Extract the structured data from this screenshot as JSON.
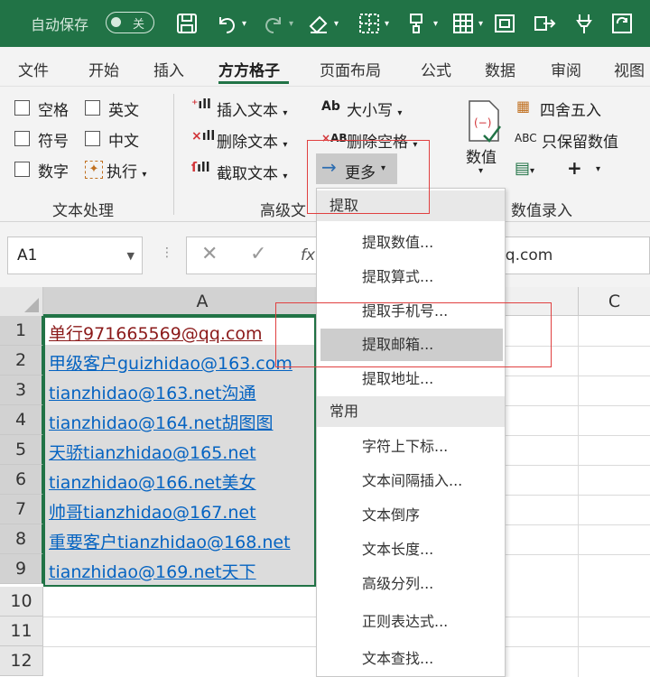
{
  "titlebar": {
    "autosave_label": "自动保存",
    "toggle_label": "关"
  },
  "menubar": {
    "tabs": [
      "文件",
      "开始",
      "插入",
      "方方格子",
      "页面布局",
      "公式",
      "数据",
      "审阅",
      "视图"
    ]
  },
  "ribbon": {
    "text_processing": {
      "checkboxes": [
        "空格",
        "英文",
        "符号",
        "中文",
        "数字"
      ],
      "execute": "执行",
      "group_label": "文本处理"
    },
    "advanced_text": {
      "insert_text": "插入文本",
      "delete_text": "删除文本",
      "extract_text": "截取文本",
      "case_label": "大小写",
      "case_icon": "Ab",
      "delete_spaces": "删除空格",
      "delete_spaces_icon": "AB",
      "more": "更多",
      "group_label": "高级文"
    },
    "numeric_entry": {
      "numeric_label": "数值",
      "round": "四舍五入",
      "keep_values": "只保留数值",
      "keep_values_icon": "ABC",
      "group_label": "数值录入"
    }
  },
  "formula_bar": {
    "name_box": "A1",
    "fx": "fx",
    "formula_visible_tail": "qq.com"
  },
  "grid": {
    "col_a": "A",
    "col_c": "C",
    "rows": [
      "1",
      "2",
      "3",
      "4",
      "5",
      "6",
      "7",
      "8",
      "9",
      "10",
      "11",
      "12"
    ],
    "cells": [
      "单行971665569@qq.com",
      "甲级客户guizhidao@163.com",
      "tianzhidao@163.net沟通",
      "tianzhidao@164.net胡图图",
      "天骄tianzhidao@165.net",
      "tianzhidao@166.net美女",
      "帅哥tianzhidao@167.net",
      "重要客户tianzhidao@168.net",
      "tianzhidao@169.net天下"
    ]
  },
  "dropdown": {
    "section_extract": "提取",
    "extract_items": [
      "提取数值...",
      "提取算式...",
      "提取手机号...",
      "提取邮箱...",
      "提取地址..."
    ],
    "section_common": "常用",
    "common_items": [
      "字符上下标...",
      "文本间隔插入...",
      "文本倒序",
      "文本长度...",
      "高级分列...",
      "正则表达式...",
      "文本查找..."
    ]
  },
  "colors": {
    "excel_green": "#217346",
    "link_blue": "#0563c1",
    "annotation_red": "#e04040"
  }
}
